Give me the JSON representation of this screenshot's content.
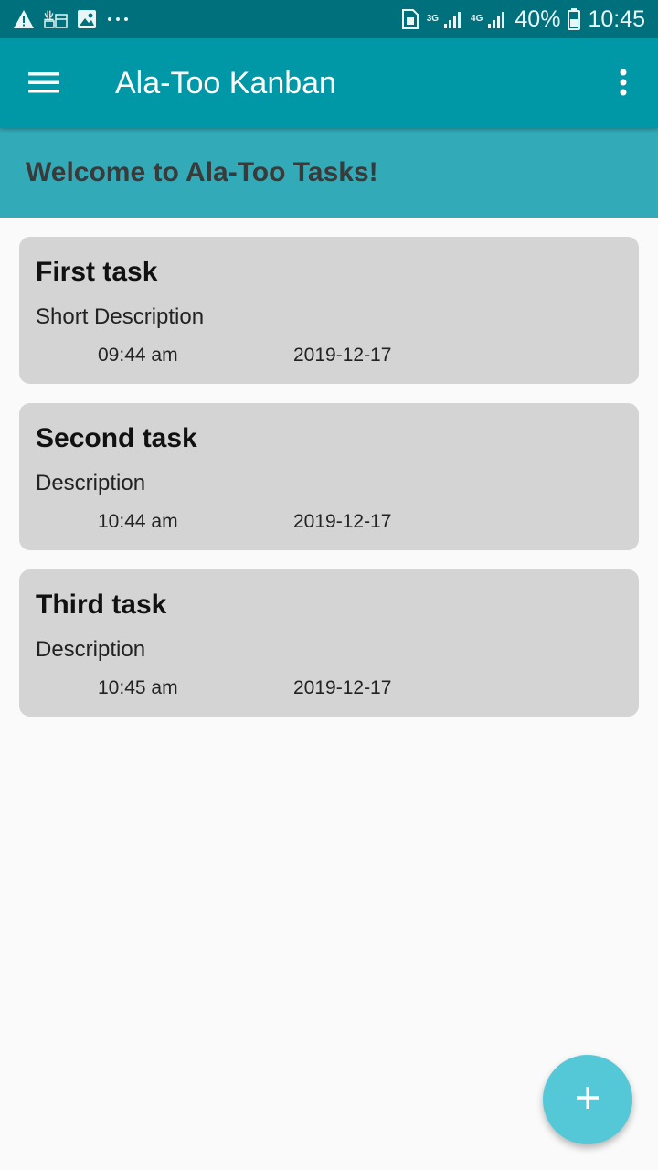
{
  "status_bar": {
    "left_icons": [
      "warning-icon",
      "job-badge-icon",
      "image-icon",
      "more-notifications-icon"
    ],
    "net1": "3G",
    "net2": "4G",
    "battery": "40%",
    "time": "10:45"
  },
  "app_bar": {
    "title": "Ala-Too Kanban",
    "menu_icon": "hamburger-menu-icon",
    "more_icon": "more-vert-icon",
    "background": "#0097a7"
  },
  "banner": {
    "text": "Welcome to Ala-Too Tasks!",
    "background": "#32aab8"
  },
  "tasks": [
    {
      "title": "First task",
      "description": "Short Description",
      "time": "09:44 am",
      "date": "2019-12-17"
    },
    {
      "title": "Second task",
      "description": "Description",
      "time": "10:44 am",
      "date": "2019-12-17"
    },
    {
      "title": "Third task",
      "description": "Description",
      "time": "10:45 am",
      "date": "2019-12-17"
    }
  ],
  "fab": {
    "icon": "add-icon",
    "background": "#55c8d8"
  }
}
